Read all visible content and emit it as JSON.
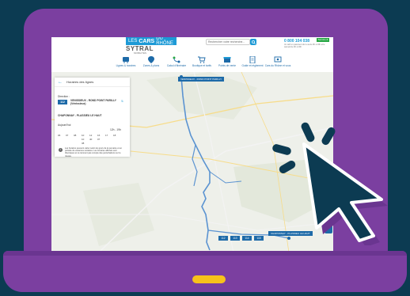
{
  "brand": {
    "prefix": "LES",
    "name": "CARS",
    "suffix": "DU RHÔNE",
    "sub_brand": "SYTRAL",
    "sub_brand_note": "MOBILITÉS"
  },
  "search": {
    "placeholder": "Rechercher votre recherche..."
  },
  "contact": {
    "phone": "0 800 104 038",
    "badge": "Service & appel gratuits",
    "note": "Un tarif un paiement du lu-sa de 8h à 19h et le samedi de 9h à 19h"
  },
  "nav": [
    {
      "label": "Lignes & horaires",
      "icon": "bus-icon"
    },
    {
      "label": "Zones & plans",
      "icon": "map-pin-icon"
    },
    {
      "label": "Calcul d'itinéraire",
      "icon": "route-icon"
    },
    {
      "label": "Boutique et tarifs",
      "icon": "cart-icon"
    },
    {
      "label": "Points de vente",
      "icon": "store-icon"
    },
    {
      "label": "Guide et règlement",
      "icon": "document-icon"
    },
    {
      "label": "Cars du Rhône et vous",
      "icon": "people-icon"
    }
  ],
  "panel": {
    "title": "Horaires des lignes",
    "direction_label": "Direction :",
    "line_number": "112",
    "direction_value": "VENISSIEUX - ROND POINT PARILLY (Vénissieux)",
    "stop": "CHAPONNAY - PLASSIEU LE HAUT",
    "date_label": "Aujourd'hui",
    "hours_range": "12h - 19h",
    "time_headers": [
      "06",
      "07",
      "08",
      "10",
      "12",
      "16",
      "17",
      "18"
    ],
    "time_values": [
      "",
      "",
      "",
      "10",
      "40",
      "07",
      "",
      ""
    ],
    "time_values_2": [
      "",
      "",
      "",
      "38",
      "",
      "",
      "",
      ""
    ],
    "info": "Les horaires peuvent varier selon les jours de la semaine et en période de vacances scolaires. Les horaires affichés sont théoriques et ne tiennent pas compte des perturbations sur le réseau."
  },
  "map_labels": {
    "origin": "VENISSIEUX - ROND POINT PARILLY",
    "destination": "CHAPONNAY - PLASSIEU LE HAUT"
  },
  "stop_lines": [
    "112",
    "113",
    "114",
    "115"
  ],
  "colors": {
    "frame": "#7b3fa0",
    "background": "#0c3b52",
    "accent": "#1d9ad6",
    "route": "#5b93d1",
    "slot": "#f7c21b"
  }
}
